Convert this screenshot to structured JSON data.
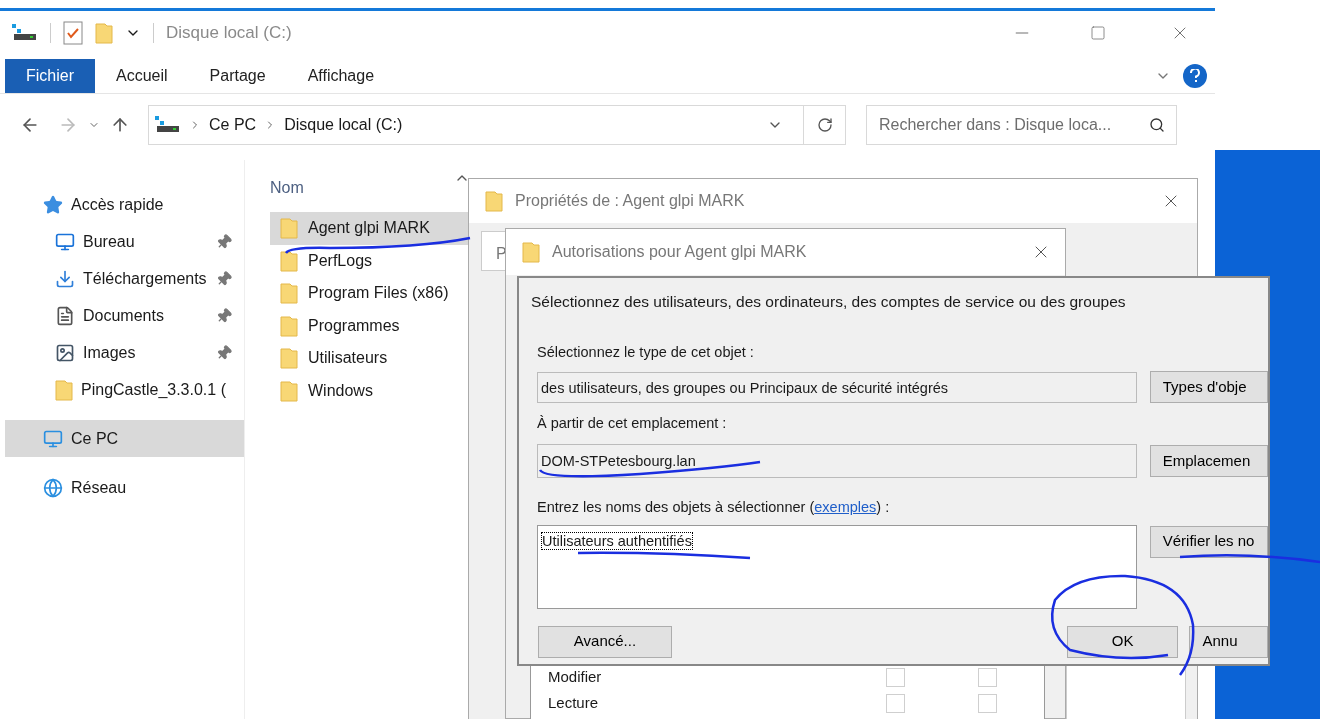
{
  "explorer": {
    "title": "Disque local (C:)",
    "ribbon_tabs": [
      {
        "label": "Fichier",
        "selected": true
      },
      {
        "label": "Accueil",
        "selected": false
      },
      {
        "label": "Partage",
        "selected": false
      },
      {
        "label": "Affichage",
        "selected": false
      }
    ],
    "breadcrumb": [
      "Ce PC",
      "Disque local (C:)"
    ],
    "search": {
      "placeholder": "Rechercher dans : Disque loca..."
    },
    "nav": [
      {
        "label": "Accès rapide",
        "kind": "star",
        "selected": false,
        "children": [
          {
            "label": "Bureau",
            "kind": "desktop",
            "selected": false,
            "pinned": true
          },
          {
            "label": "Téléchargements",
            "kind": "download",
            "selected": false,
            "pinned": true
          },
          {
            "label": "Documents",
            "kind": "document",
            "selected": false,
            "pinned": true
          },
          {
            "label": "Images",
            "kind": "image",
            "selected": false,
            "pinned": true
          },
          {
            "label": "PingCastle_3.3.0.1 (",
            "kind": "folder",
            "selected": false,
            "pinned": false
          }
        ]
      },
      {
        "label": "Ce PC",
        "kind": "pc",
        "selected": true
      },
      {
        "label": "Réseau",
        "kind": "network",
        "selected": false
      }
    ],
    "column": "Nom",
    "files": [
      {
        "name": "Agent glpi MARK",
        "selected": true
      },
      {
        "name": "PerfLogs",
        "selected": false
      },
      {
        "name": "Program Files (x86)",
        "selected": false
      },
      {
        "name": "Programmes",
        "selected": false
      },
      {
        "name": "Utilisateurs",
        "selected": false
      },
      {
        "name": "Windows",
        "selected": false
      }
    ]
  },
  "properties_dialog": {
    "title": "Propriétés de : Agent glpi MARK",
    "tab": "P",
    "permissions": [
      {
        "name": "Modifier",
        "allow": false,
        "deny": false
      },
      {
        "name": "Lecture",
        "allow": false,
        "deny": false
      }
    ]
  },
  "permissions_dialog": {
    "title": "Autorisations pour Agent glpi MARK"
  },
  "select_dialog": {
    "heading": "Sélectionnez des utilisateurs, des ordinateurs, des comptes de service ou des groupes",
    "type_label": "Sélectionnez le type de cet objet :",
    "type_value": "des utilisateurs, des groupes ou Principaux de sécurité intégrés",
    "type_button": "Types d'obje",
    "location_label": "À partir de cet emplacement :",
    "location_value": "DOM-STPetesbourg.lan",
    "location_button": "Emplacemen",
    "names_label": "Entrez les noms des objets à sélectionner (",
    "names_link": "exemples",
    "names_label_end": ") :",
    "names_value": "Utilisateurs authentifiés",
    "check_button": "Vérifier les no",
    "advanced_button": "Avancé...",
    "ok_button": "OK",
    "cancel_button": "Annu"
  }
}
